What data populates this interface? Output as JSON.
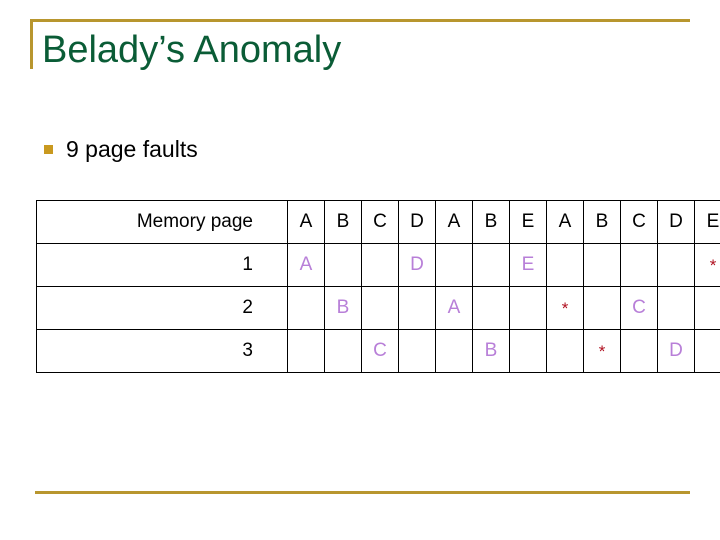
{
  "slide": {
    "title": "Belady’s Anomaly",
    "bullets": [
      {
        "marker": "square-bullet",
        "text": "9 page faults"
      }
    ],
    "colors": {
      "title": "#0a5c36",
      "accent_rule": "#b8962e",
      "bullet_marker": "#c9991f",
      "page_letter": "#b87fd8",
      "fault_marker": "#b01020",
      "table_border": "#000000",
      "background": "#ffffff"
    }
  },
  "table": {
    "label_header": "Memory page",
    "reference_string": [
      "A",
      "B",
      "C",
      "D",
      "A",
      "B",
      "E",
      "A",
      "B",
      "C",
      "D",
      "E"
    ],
    "fault_symbol": "*",
    "rows": [
      {
        "label": "1",
        "cells": [
          "A",
          "",
          "",
          "D",
          "",
          "",
          "E",
          "",
          "",
          "",
          "",
          "*"
        ]
      },
      {
        "label": "2",
        "cells": [
          "",
          "B",
          "",
          "",
          "A",
          "",
          "",
          "*",
          "",
          "C",
          "",
          ""
        ]
      },
      {
        "label": "3",
        "cells": [
          "",
          "",
          "C",
          "",
          "",
          "B",
          "",
          "",
          "*",
          "",
          "D",
          ""
        ]
      }
    ]
  }
}
